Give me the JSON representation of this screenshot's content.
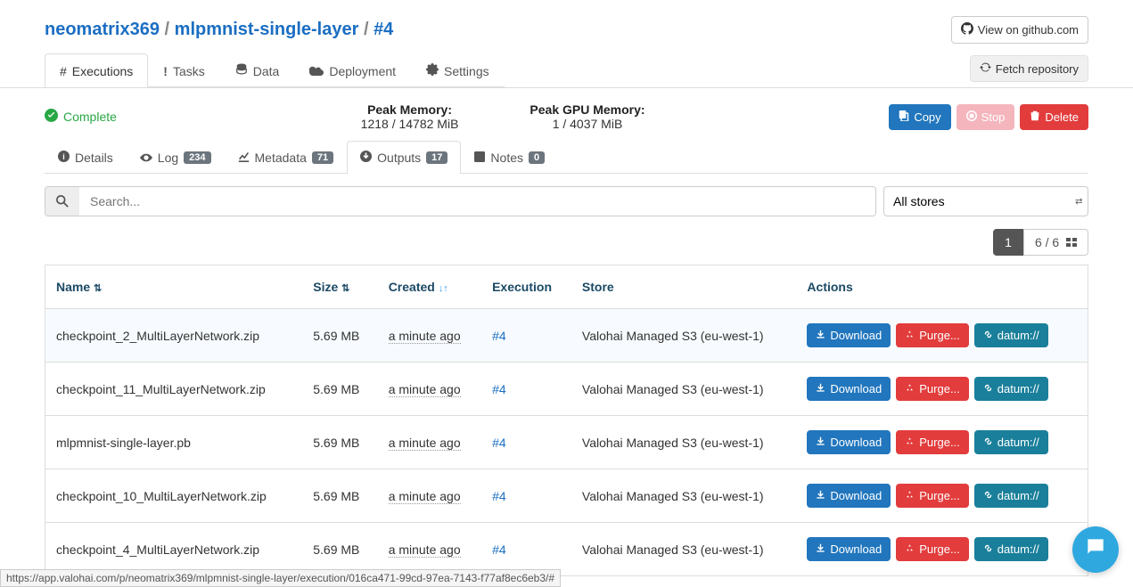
{
  "breadcrumb": {
    "owner": "neomatrix369",
    "project": "mlpmnist-single-layer",
    "run": "#4",
    "sep": " / "
  },
  "github_btn": "View on github.com",
  "main_tabs": {
    "executions": "Executions",
    "tasks": "Tasks",
    "data": "Data",
    "deployment": "Deployment",
    "settings": "Settings"
  },
  "fetch_btn": "Fetch repository",
  "status": {
    "label": "Complete",
    "peak_mem_label": "Peak Memory:",
    "peak_mem_val": "1218 / 14782 MiB",
    "peak_gpu_label": "Peak GPU Memory:",
    "peak_gpu_val": "1 / 4037 MiB"
  },
  "action_buttons": {
    "copy": "Copy",
    "stop": "Stop",
    "delete": "Delete"
  },
  "subtabs": {
    "details": "Details",
    "log": "Log",
    "log_badge": "234",
    "metadata": "Metadata",
    "metadata_badge": "71",
    "outputs": "Outputs",
    "outputs_badge": "17",
    "notes": "Notes",
    "notes_badge": "0"
  },
  "search": {
    "placeholder": "Search..."
  },
  "store_select": "All stores",
  "pagination": {
    "current": "1",
    "total": "6 / 6"
  },
  "table": {
    "headers": {
      "name": "Name",
      "size": "Size",
      "created": "Created",
      "execution": "Execution",
      "store": "Store",
      "actions": "Actions"
    },
    "row_buttons": {
      "download": "Download",
      "purge": "Purge...",
      "datum": "datum://"
    },
    "rows": [
      {
        "name": "checkpoint_2_MultiLayerNetwork.zip",
        "size": "5.69 MB",
        "created": "a minute ago",
        "execution": "#4",
        "store": "Valohai Managed S3 (eu-west-1)"
      },
      {
        "name": "checkpoint_11_MultiLayerNetwork.zip",
        "size": "5.69 MB",
        "created": "a minute ago",
        "execution": "#4",
        "store": "Valohai Managed S3 (eu-west-1)"
      },
      {
        "name": "mlpmnist-single-layer.pb",
        "size": "5.69 MB",
        "created": "a minute ago",
        "execution": "#4",
        "store": "Valohai Managed S3 (eu-west-1)"
      },
      {
        "name": "checkpoint_10_MultiLayerNetwork.zip",
        "size": "5.69 MB",
        "created": "a minute ago",
        "execution": "#4",
        "store": "Valohai Managed S3 (eu-west-1)"
      },
      {
        "name": "checkpoint_4_MultiLayerNetwork.zip",
        "size": "5.69 MB",
        "created": "a minute ago",
        "execution": "#4",
        "store": "Valohai Managed S3 (eu-west-1)"
      }
    ]
  },
  "footer_url": "https://app.valohai.com/p/neomatrix369/mlpmnist-single-layer/execution/016ca471-99cd-97ea-7143-f77af8ec6eb3/#"
}
